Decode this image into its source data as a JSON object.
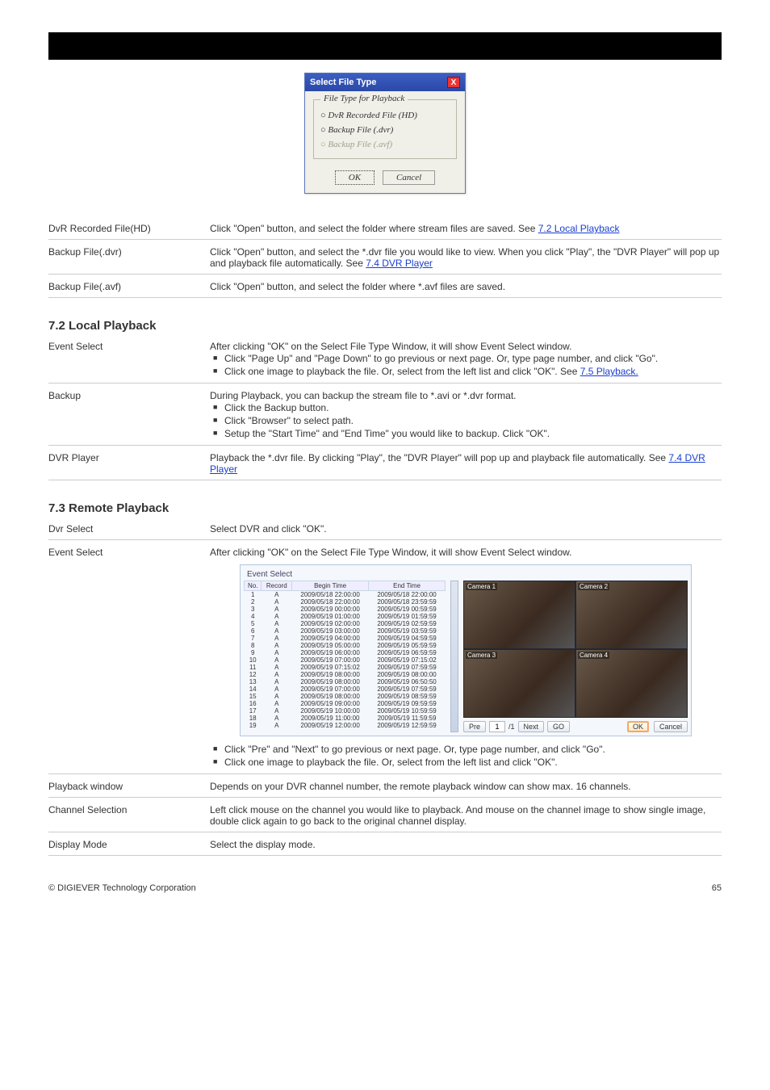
{
  "dialog": {
    "title": "Select File Type",
    "group_label": "File Type for Playback",
    "opts": {
      "hd": "DvR Recorded File (HD)",
      "dvr": "Backup File (.dvr)",
      "avf": "Backup File (.avf)"
    },
    "ok": "OK",
    "cancel": "Cancel"
  },
  "rows": [
    {
      "label": "DvR Recorded File(HD)",
      "text": "Click \"Open\" button, and select the folder where stream files are saved. See ",
      "link": "7.2 Local Playback"
    },
    {
      "label": "Backup File(.dvr)",
      "text": "Click \"Open\" button, and select the *.dvr file you would like to view. When you click \"Play\", the \"DVR Player\" will pop up and playback file automatically. See ",
      "link": "7.4 DVR Player"
    },
    {
      "label": "Backup File(.avf)",
      "text": "Click \"Open\" button, and select the folder where *.avf files are saved."
    }
  ],
  "local": {
    "heading": "7.2 Local Playback",
    "row1_label": "Event Select",
    "row1_text": "After clicking \"OK\" on the Select File Type Window, it will show Event Select window.",
    "row1_bullets": [
      {
        "text": "Click \"Page Up\" and \"Page Down\" to go previous or next page. Or, type page number, and click \"Go\"."
      },
      {
        "text": "Click one image to playback the file. Or, select from the left list and click \"OK\". See ",
        "link": "7.5 Playback."
      }
    ],
    "row2_label": "Backup",
    "row2_text": "During Playback, you can backup the stream file to *.avi or *.dvr format.",
    "row2_bullets": [
      "Click the Backup button.",
      "Click \"Browser\" to select path.",
      "Setup the \"Start Time\" and \"End Time\" you would like to backup. Click \"OK\"."
    ],
    "row3_label": "DVR Player",
    "row3_text": "Playback the *.dvr file. By clicking \"Play\", the \"DVR Player\" will pop up and playback file automatically. See ",
    "row3_link": "7.4 DVR Player"
  },
  "remote": {
    "heading": "7.3 Remote Playback",
    "row1_label": "Dvr Select",
    "row1_text": "Select DVR and click \"OK\".",
    "row2_label": "Event Select",
    "row2_text": "After clicking \"OK\" on the Select File Type Window, it will show Event Select window.",
    "event_panel_title": "Event Select",
    "columns": [
      "No.",
      "Record",
      "Begin Time",
      "End Time"
    ],
    "rows": [
      [
        "1",
        "A",
        "2009/05/18 22:00:00",
        "2009/05/18 22:00:00"
      ],
      [
        "2",
        "A",
        "2009/05/18 22:00:00",
        "2009/05/18 23:59:59"
      ],
      [
        "3",
        "A",
        "2009/05/19 00:00:00",
        "2009/05/19 00:59:59"
      ],
      [
        "4",
        "A",
        "2009/05/19 01:00:00",
        "2009/05/19 01:59:59"
      ],
      [
        "5",
        "A",
        "2009/05/19 02:00:00",
        "2009/05/19 02:59:59"
      ],
      [
        "6",
        "A",
        "2009/05/19 03:00:00",
        "2009/05/19 03:59:59"
      ],
      [
        "7",
        "A",
        "2009/05/19 04:00:00",
        "2009/05/19 04:59:59"
      ],
      [
        "8",
        "A",
        "2009/05/19 05:00:00",
        "2009/05/19 05:59:59"
      ],
      [
        "9",
        "A",
        "2009/05/19 06:00:00",
        "2009/05/19 06:59:59"
      ],
      [
        "10",
        "A",
        "2009/05/19 07:00:00",
        "2009/05/19 07:15:02"
      ],
      [
        "11",
        "A",
        "2009/05/19 07:15:02",
        "2009/05/19 07:59:59"
      ],
      [
        "12",
        "A",
        "2009/05/19 08:00:00",
        "2009/05/19 08:00:00"
      ],
      [
        "13",
        "A",
        "2009/05/19 08:00:00",
        "2009/05/19 06:50:50"
      ],
      [
        "14",
        "A",
        "2009/05/19 07:00:00",
        "2009/05/19 07:59:59"
      ],
      [
        "15",
        "A",
        "2009/05/19 08:00:00",
        "2009/05/19 08:59:59"
      ],
      [
        "16",
        "A",
        "2009/05/19 09:00:00",
        "2009/05/19 09:59:59"
      ],
      [
        "17",
        "A",
        "2009/05/19 10:00:00",
        "2009/05/19 10:59:59"
      ],
      [
        "18",
        "A",
        "2009/05/19 11:00:00",
        "2009/05/19 11:59:59"
      ],
      [
        "19",
        "A",
        "2009/05/19 12:00:00",
        "2009/05/19 12:59:59"
      ]
    ],
    "cameras": [
      "Camera 1",
      "Camera 2",
      "Camera 3",
      "Camera 4"
    ],
    "pager": {
      "pre": "Pre",
      "page": "1",
      "total": "/1",
      "next": "Next",
      "go": "GO"
    },
    "ok": "OK",
    "cancel": "Cancel",
    "after_bullets_label": "",
    "after_bullets": [
      "Click \"Pre\" and \"Next\" to go previous or next page. Or, type page number, and click \"Go\".",
      "Click one image to playback the file. Or, select from the left list and click \"OK\"."
    ],
    "row3_label": "Playback window",
    "row3_text": "Depends on your DVR channel number, the remote playback window can show max. 16 channels.",
    "row4_label": "Channel Selection",
    "row4_text": "Left click mouse on the channel you would like to playback. And mouse on the channel image to show single image, double click again to go back to the original channel display.",
    "row5_label": "Display Mode",
    "row5_text": "Select the display mode."
  },
  "footer": {
    "left": "© DIGIEVER Technology Corporation",
    "right": "65"
  }
}
